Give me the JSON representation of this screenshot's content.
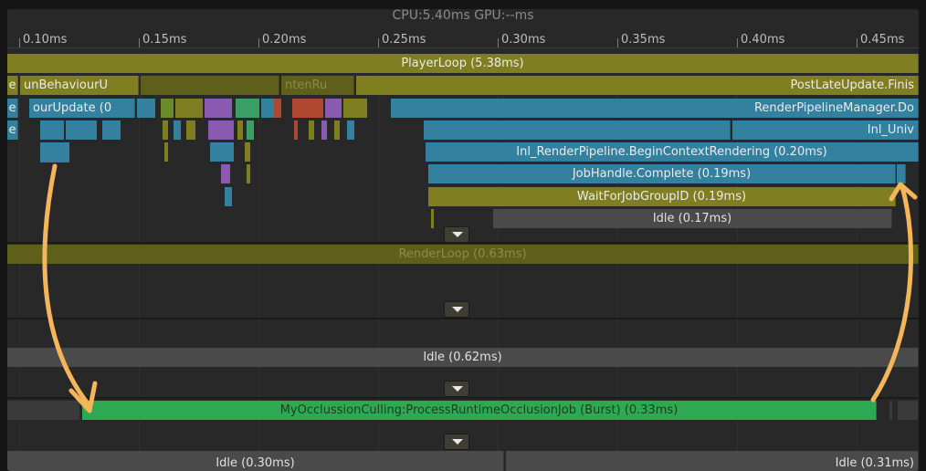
{
  "header": {
    "title": "CPU:5.40ms   GPU:--ms"
  },
  "ruler": {
    "ticks": [
      "0.10ms",
      "0.15ms",
      "0.20ms",
      "0.25ms",
      "0.30ms",
      "0.35ms",
      "0.40ms",
      "0.45ms"
    ]
  },
  "main_thread": {
    "player_loop": "PlayerLoop (5.38ms)",
    "run_behaviour_trunc": "unBehaviourU",
    "partial_ru": "ntenRu",
    "post_late_update": "PostLateUpdate.Finis",
    "behaviour_update_trunc": "ourUpdate (0",
    "render_pipeline_manager": "RenderPipelineManager.Do",
    "inl_univ": "Inl_Univ",
    "begin_context_rendering": "Inl_RenderPipeline.BeginContextRendering (0.20ms)",
    "job_handle_complete": "JobHandle.Complete (0.19ms)",
    "wait_for_job_group": "WaitForJobGroupID (0.19ms)",
    "idle_main": "Idle (0.17ms)",
    "left_e1": "e",
    "left_e2": "e",
    "left_e3": "e"
  },
  "render_thread": {
    "render_loop": "RenderLoop (0.63ms)"
  },
  "worker_thread_1": {
    "idle": "Idle (0.62ms)"
  },
  "worker_thread_2": {
    "job": "MyOcclussionCulling:ProcessRuntimeOcclusionJob (Burst) (0.33ms)"
  },
  "worker_thread_3": {
    "idle_left": "Idle (0.30ms)",
    "idle_right": "Idle (0.31ms)"
  },
  "colors": {
    "arrow": "#f5b55a",
    "job": "#2fa852",
    "scripts": "#33809f",
    "other": "#7f7f22"
  }
}
